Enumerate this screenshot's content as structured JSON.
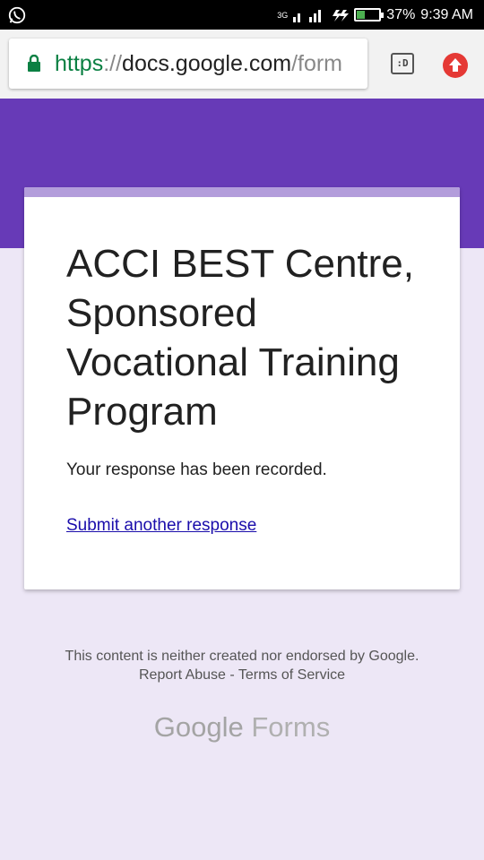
{
  "status_bar": {
    "network": "3G",
    "battery_percent": "37%",
    "battery_level": 0.37,
    "time": "9:39 AM",
    "notification_icon": "whatsapp-icon"
  },
  "browser": {
    "url_scheme": "https",
    "url_sep": "://",
    "url_host": "docs.google.com",
    "url_path": "/form",
    "tab_switcher_label": ":D",
    "lock_icon": "lock-icon",
    "upload_icon": "upload-icon"
  },
  "colors": {
    "header": "#673ab7",
    "accent": "#b39ddb",
    "background": "#ede7f6",
    "link": "#1a0dab",
    "secure": "#0b8043"
  },
  "form": {
    "title": "ACCI BEST Centre, Sponsored Vocational Training Program",
    "confirmation": "Your response has been recorded.",
    "submit_another": "Submit another response"
  },
  "footer": {
    "disclaimer": "This content is neither created nor endorsed by Google.",
    "report_abuse": "Report Abuse",
    "divider": "-",
    "terms": "Terms of Service",
    "brand_google": "Google",
    "brand_forms": "Forms"
  }
}
